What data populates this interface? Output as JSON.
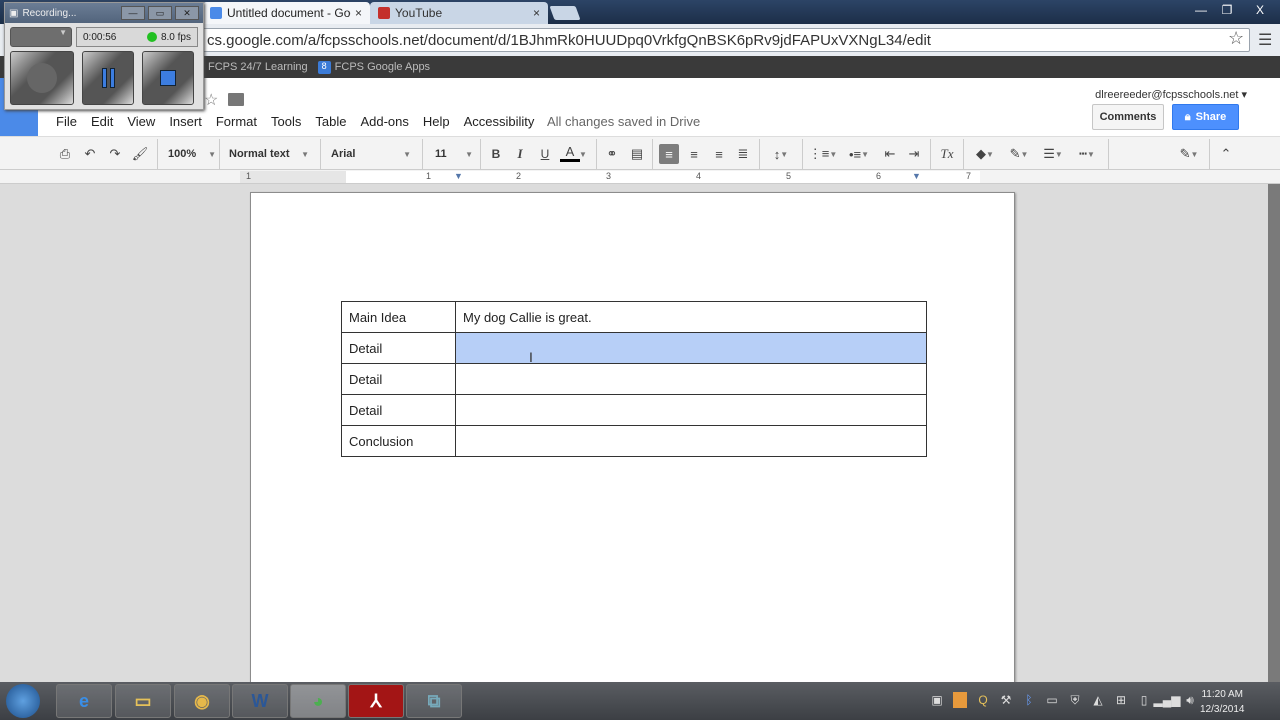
{
  "browser": {
    "tabs": [
      {
        "title": "Untitled document - Goog",
        "favicon": "docs-icon",
        "active": true
      },
      {
        "title": "YouTube",
        "favicon": "youtube-icon",
        "active": false
      }
    ],
    "close_glyph": "×",
    "window_controls": {
      "minimize": "—",
      "restore": "❐",
      "close": "X"
    },
    "url": "cs.google.com/a/fcpsschools.net/document/d/1BJhmRk0HUUDpq0VrkfgQnBSK6pRv9jdFAPUxVXNgL34/edit",
    "bookmarks": [
      {
        "label": "FCPS 24/7 Learning",
        "icon": ""
      },
      {
        "label": "FCPS Google Apps",
        "icon": "8"
      }
    ]
  },
  "recorder": {
    "title": "Recording...",
    "elapsed": "0:00:56",
    "fps": "8.0 fps",
    "status_color": "#22c022"
  },
  "docs": {
    "menu": [
      "File",
      "Edit",
      "View",
      "Insert",
      "Format",
      "Tools",
      "Table",
      "Add-ons",
      "Help",
      "Accessibility"
    ],
    "save_status": "All changes saved in Drive",
    "account": "dlreereeder@fcpsschools.net ▾",
    "comments_label": "Comments",
    "share_label": "Share",
    "toolbar": {
      "zoom": "100%",
      "style": "Normal text",
      "font": "Arial",
      "size": "11",
      "bold": "B",
      "italic": "I",
      "underline": "U",
      "text_color": "A"
    },
    "ruler_labels": [
      "1",
      "1",
      "2",
      "3",
      "4",
      "5",
      "6",
      "7"
    ]
  },
  "table": {
    "rows": [
      {
        "label": "Main Idea",
        "content": "My dog Callie is great.",
        "highlighted": false
      },
      {
        "label": "Detail",
        "content": "",
        "highlighted": true
      },
      {
        "label": "Detail",
        "content": "",
        "highlighted": false
      },
      {
        "label": "Detail",
        "content": "",
        "highlighted": false
      },
      {
        "label": "Conclusion",
        "content": "",
        "highlighted": false
      }
    ]
  },
  "taskbar": {
    "apps": [
      "ie-icon",
      "explorer-icon",
      "outlook-icon",
      "word-icon",
      "chrome-icon",
      "acrobat-icon",
      "network-icon"
    ],
    "time": "11:20 AM",
    "date": "12/3/2014"
  }
}
